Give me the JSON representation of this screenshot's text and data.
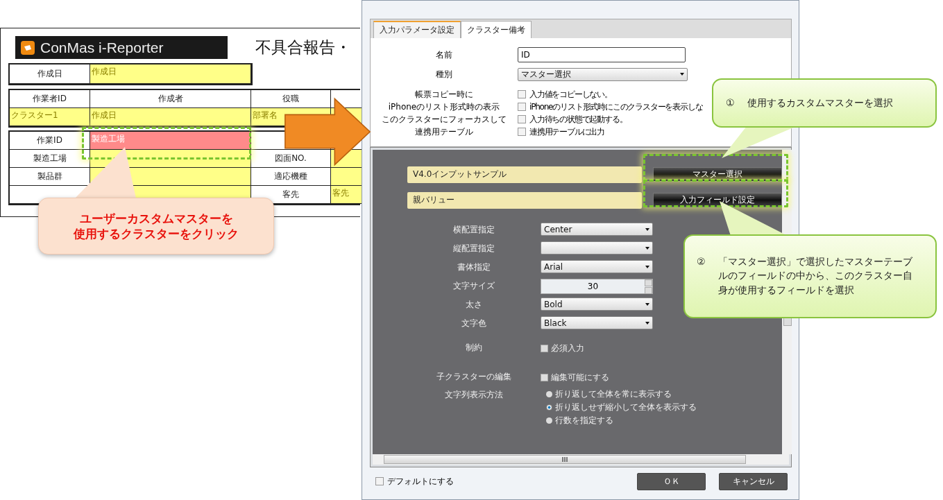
{
  "report_form": {
    "logo": "ConMas i-Reporter",
    "title": "不具合報告・",
    "date_row": {
      "label": "作成日",
      "value": "作成日"
    },
    "header": [
      "作業者ID",
      "作成者",
      "役職"
    ],
    "header_values": [
      "クラスター1",
      "作成日",
      "部署名"
    ],
    "rows": [
      {
        "label": "作業ID",
        "value": "製造工場",
        "selected": true
      },
      {
        "label": "製造工場",
        "label_2": "図面NO.",
        "selected": false
      },
      {
        "label": "製品群",
        "label_2": "適応機種",
        "selected": false
      },
      {
        "label_2": "客先",
        "value_2": "客先",
        "selected": false
      }
    ]
  },
  "dialog": {
    "tabs": [
      {
        "label": "入力パラメータ設定",
        "selected": true
      },
      {
        "label": "クラスター備考",
        "selected": false
      }
    ],
    "name": {
      "label": "名前",
      "value": "ID"
    },
    "type": {
      "label": "種別",
      "value": "マスター選択"
    },
    "options": [
      {
        "label": "帳票コピー時に",
        "text": "入力値をコピーしない。",
        "checked": false
      },
      {
        "label": "iPhoneのリスト形式時の表示",
        "text": "iPhoneのリスト形式時にこのクラスターを表示しな",
        "checked": false
      },
      {
        "label": "このクラスターにフォーカスして",
        "text": "入力待ちの状態で起動する。",
        "checked": false
      },
      {
        "label": "連携用テーブル",
        "text": "連携用テーブルに出力",
        "checked": false
      }
    ],
    "master_rows": [
      {
        "value": "V4.0インプットサンプル",
        "button": "マスター選択"
      },
      {
        "value": "親バリュー",
        "button": "入力フィールド設定"
      }
    ],
    "settings": [
      {
        "kind": "select",
        "label": "横配置指定",
        "value": "Center"
      },
      {
        "kind": "select",
        "label": "縦配置指定"
      },
      {
        "kind": "select",
        "label": "書体指定",
        "value": "Arial"
      },
      {
        "kind": "spin",
        "label": "文字サイズ",
        "value": "30"
      },
      {
        "kind": "select",
        "label": "太さ",
        "value": "Bold"
      },
      {
        "kind": "select",
        "label": "文字色",
        "value": "Black"
      },
      {
        "kind": "checkbox",
        "label": "制約",
        "text": "必須入力",
        "checked": false
      },
      {
        "kind": "checkbox",
        "label": "子クラスターの編集",
        "text": "編集可能にする",
        "checked": false
      },
      {
        "kind": "radio",
        "label": "文字列表示方法",
        "options": [
          {
            "text": "折り返して全体を常に表示する",
            "selected": false
          },
          {
            "text": "折り返しせず縮小して全体を表示する",
            "selected": true
          },
          {
            "text": "行数を指定する",
            "selected": false
          }
        ]
      }
    ],
    "default_option": {
      "text": "デフォルトにする",
      "checked": false
    },
    "buttons": [
      "ＯＫ",
      "キャンセル"
    ]
  },
  "callouts": [
    {
      "kind": "peach",
      "lines": [
        "ユーザーカスタムマスターを",
        "使用するクラスターをクリック"
      ]
    },
    {
      "kind": "green",
      "number": "①",
      "text": "使用するカスタムマスターを選択"
    },
    {
      "kind": "green",
      "number": "②",
      "text": "「マスター選択」で選択したマスターテーブルのフィールドの中から、このクラスター自身が使用するフィールドを選択"
    }
  ]
}
